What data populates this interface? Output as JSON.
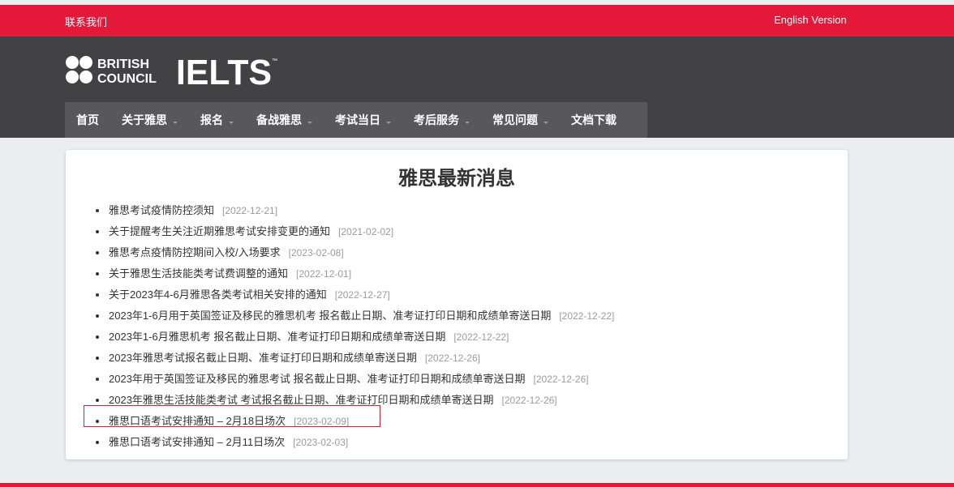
{
  "topbar": {
    "contact": "联系我们",
    "english": "English Version"
  },
  "logo": {
    "line1": "BRITISH",
    "line2": "COUNCIL",
    "brand": "IELTS",
    "tm": "™"
  },
  "nav": [
    {
      "label": "首页",
      "dropdown": false
    },
    {
      "label": "关于雅思",
      "dropdown": true
    },
    {
      "label": "报名",
      "dropdown": true
    },
    {
      "label": "备战雅思",
      "dropdown": true
    },
    {
      "label": "考试当日",
      "dropdown": true
    },
    {
      "label": "考后服务",
      "dropdown": true
    },
    {
      "label": "常见问题",
      "dropdown": true
    },
    {
      "label": "文档下载",
      "dropdown": false
    }
  ],
  "main": {
    "heading": "雅思最新消息",
    "news": [
      {
        "title": "雅思考试疫情防控须知",
        "date": "[2022-12-21]"
      },
      {
        "title": "关于提醒考生关注近期雅思考试安排变更的通知",
        "date": "[2021-02-02]"
      },
      {
        "title": "雅思考点疫情防控期间入校/入场要求",
        "date": "[2023-02-08]"
      },
      {
        "title": "关于雅思生活技能类考试费调整的通知",
        "date": "[2022-12-01]"
      },
      {
        "title": "关于2023年4-6月雅思各类考试相关安排的通知",
        "date": "[2022-12-27]"
      },
      {
        "title": "2023年1-6月用于英国签证及移民的雅思机考 报名截止日期、准考证打印日期和成绩单寄送日期",
        "date": "[2022-12-22]"
      },
      {
        "title": "2023年1-6月雅思机考 报名截止日期、准考证打印日期和成绩单寄送日期",
        "date": "[2022-12-22]"
      },
      {
        "title": "2023年雅思考试报名截止日期、准考证打印日期和成绩单寄送日期",
        "date": "[2022-12-26]"
      },
      {
        "title": "2023年用于英国签证及移民的雅思考试 报名截止日期、准考证打印日期和成绩单寄送日期",
        "date": "[2022-12-26]"
      },
      {
        "title": "2023年雅思生活技能类考试 考试报名截止日期、准考证打印日期和成绩单寄送日期",
        "date": "[2022-12-26]"
      },
      {
        "title": "雅思口语考试安排通知 – 2月18日场次",
        "date": "[2023-02-09]"
      },
      {
        "title": "雅思口语考试安排通知 – 2月11日场次",
        "date": "[2023-02-03]"
      }
    ]
  },
  "colors": {
    "brand_red": "#e4193a",
    "header_dark": "#424143",
    "nav_bg": "#58575a",
    "highlight_border": "#d91f2e"
  }
}
